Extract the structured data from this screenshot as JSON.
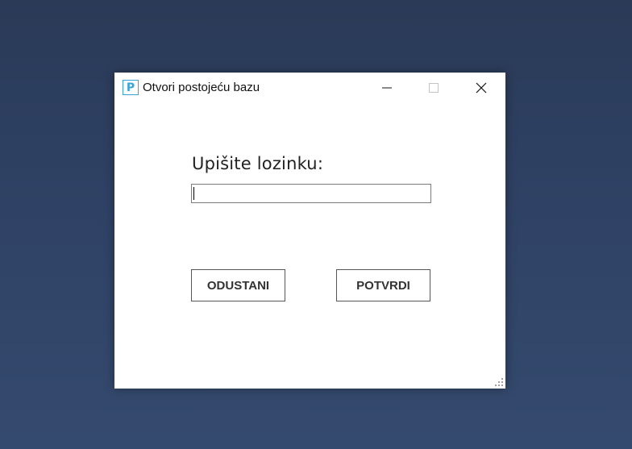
{
  "window": {
    "title": "Otvori postojeću bazu",
    "app_icon_letter": "P",
    "accent_color": "#3aa2d6",
    "controls": [
      "minimize-icon",
      "maximize-icon",
      "close-icon"
    ]
  },
  "form": {
    "prompt_label": "Upišite lozinku:",
    "password_value": "",
    "cancel_label": "ODUSTANI",
    "confirm_label": "POTVRDI"
  }
}
